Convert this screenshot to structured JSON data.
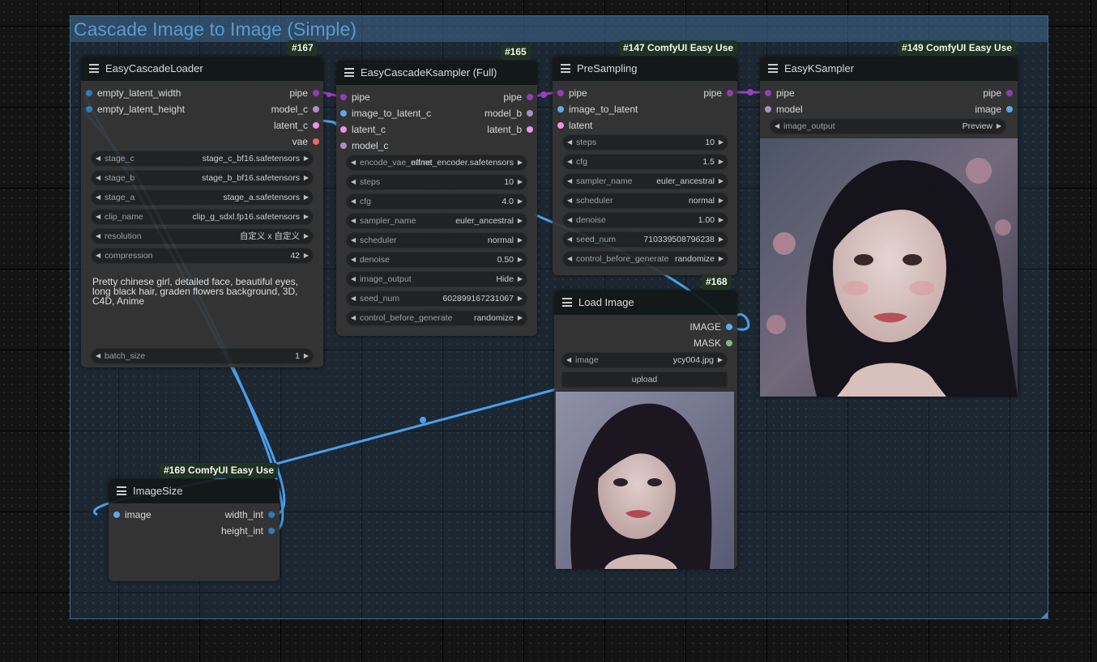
{
  "group": {
    "title": "Cascade Image to Image (Simple)"
  },
  "colors": {
    "pipe": "#9a3fc0",
    "model_c": "#b29bd8",
    "latent": "#ff9cf9",
    "vae": "#ff6e6e",
    "int": "#2f7fbf",
    "image": "#64b5f6",
    "mask": "#81c784",
    "link": "#4a9fe8",
    "badge_bg": "#1f3320"
  },
  "nodes": {
    "loader": {
      "badge": "#167",
      "title": "EasyCascadeLoader",
      "inputs": [
        "empty_latent_width",
        "empty_latent_height"
      ],
      "outputs": [
        "pipe",
        "model_c",
        "latent_c",
        "vae"
      ],
      "widgets": [
        {
          "label": "stage_c",
          "value": "stage_c_bf16.safetensors"
        },
        {
          "label": "stage_b",
          "value": "stage_b_bf16.safetensors"
        },
        {
          "label": "stage_a",
          "value": "stage_a.safetensors"
        },
        {
          "label": "clip_name",
          "value": "clip_g_sdxl.fp16.safetensors"
        },
        {
          "label": "resolution",
          "value": "自定义 x 自定义"
        },
        {
          "label": "compression",
          "value": "42"
        }
      ],
      "prompt": "Pretty chinese girl, detailed face, beautiful eyes, long black hair, graden flowers background, 3D, C4D, Anime",
      "batch": {
        "label": "batch_size",
        "value": "1"
      }
    },
    "cascade_ksampler": {
      "badge": "#165",
      "title": "EasyCascadeKsampler (Full)",
      "inputs": [
        "pipe",
        "image_to_latent_c",
        "latent_c",
        "model_c"
      ],
      "outputs": [
        "pipe",
        "model_b",
        "latent_b"
      ],
      "encode": {
        "label": "encode_vae_name",
        "value": "effnet_encoder.safetensors"
      },
      "widgets": [
        {
          "label": "steps",
          "value": "10"
        },
        {
          "label": "cfg",
          "value": "4.0"
        },
        {
          "label": "sampler_name",
          "value": "euler_ancestral"
        },
        {
          "label": "scheduler",
          "value": "normal"
        },
        {
          "label": "denoise",
          "value": "0.50"
        },
        {
          "label": "image_output",
          "value": "Hide"
        },
        {
          "label": "seed_num",
          "value": "602899167231067"
        },
        {
          "label": "control_before_generate",
          "value": "randomize"
        }
      ]
    },
    "presampling": {
      "badge": "#147 ComfyUI Easy Use",
      "title": "PreSampling",
      "inputs": [
        "pipe",
        "image_to_latent",
        "latent"
      ],
      "outputs": [
        "pipe"
      ],
      "widgets": [
        {
          "label": "steps",
          "value": "10"
        },
        {
          "label": "cfg",
          "value": "1.5"
        },
        {
          "label": "sampler_name",
          "value": "euler_ancestral"
        },
        {
          "label": "scheduler",
          "value": "normal"
        },
        {
          "label": "denoise",
          "value": "1.00"
        },
        {
          "label": "seed_num",
          "value": "710339508796238"
        },
        {
          "label": "control_before_generate",
          "value": "randomize"
        }
      ]
    },
    "ksampler": {
      "badge": "#149 ComfyUI Easy Use",
      "title": "EasyKSampler",
      "inputs": [
        "pipe",
        "model"
      ],
      "outputs": [
        "pipe",
        "image"
      ],
      "widget": {
        "label": "image_output",
        "value": "Preview"
      }
    },
    "load_image": {
      "badge": "#168",
      "title": "Load Image",
      "outputs": [
        "IMAGE",
        "MASK"
      ],
      "widget": {
        "label": "image",
        "value": "ycy004.jpg"
      },
      "upload_label": "upload"
    },
    "image_size": {
      "badge": "#169 ComfyUI Easy Use",
      "title": "ImageSize",
      "inputs": [
        "image"
      ],
      "outputs": [
        "width_int",
        "height_int"
      ]
    }
  }
}
